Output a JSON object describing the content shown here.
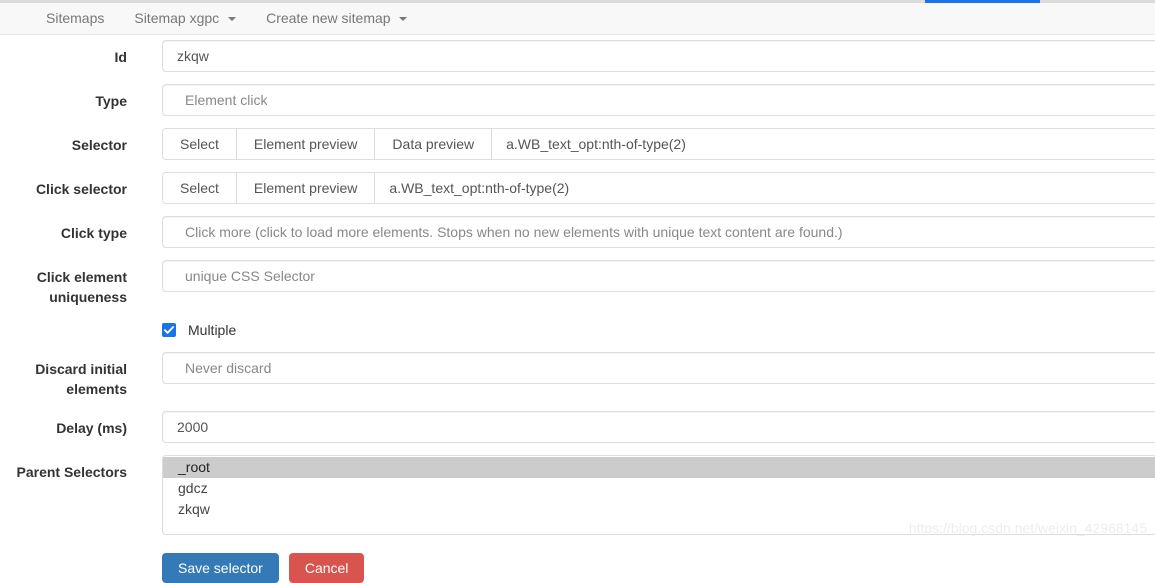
{
  "progress": {
    "accent_color": "#1a73e8",
    "track_color": "#dcdcdc"
  },
  "navbar": {
    "items": [
      {
        "label": "Sitemaps",
        "has_caret": false
      },
      {
        "label": "Sitemap xgpc",
        "has_caret": true
      },
      {
        "label": "Create new sitemap",
        "has_caret": true
      }
    ]
  },
  "form": {
    "id": {
      "label": "Id",
      "value": "zkqw"
    },
    "type": {
      "label": "Type",
      "value": "Element click"
    },
    "selector": {
      "label": "Selector",
      "select_label": "Select",
      "element_preview_label": "Element preview",
      "data_preview_label": "Data preview",
      "value": "a.WB_text_opt:nth-of-type(2)"
    },
    "click_selector": {
      "label": "Click selector",
      "select_label": "Select",
      "element_preview_label": "Element preview",
      "value": "a.WB_text_opt:nth-of-type(2)"
    },
    "click_type": {
      "label": "Click type",
      "value": "Click more (click to load more elements. Stops when no new elements with unique text content are found.)"
    },
    "click_element_uniqueness": {
      "label": "Click element uniqueness",
      "value": "unique CSS Selector"
    },
    "multiple": {
      "label": "Multiple",
      "checked": true,
      "checkbox_color": "#1a73e8"
    },
    "discard_initial_elements": {
      "label": "Discard initial elements",
      "value": "Never discard"
    },
    "delay": {
      "label": "Delay (ms)",
      "value": "2000"
    },
    "parent_selectors": {
      "label": "Parent Selectors",
      "options": [
        {
          "label": "_root",
          "selected": true
        },
        {
          "label": "gdcz",
          "selected": false
        },
        {
          "label": "zkqw",
          "selected": false
        }
      ]
    }
  },
  "actions": {
    "save_label": "Save selector",
    "save_color": "#337ab7",
    "cancel_label": "Cancel",
    "cancel_color": "#d9534f"
  },
  "watermark": {
    "text": "https://blog.csdn.net/weixin_42968145"
  }
}
